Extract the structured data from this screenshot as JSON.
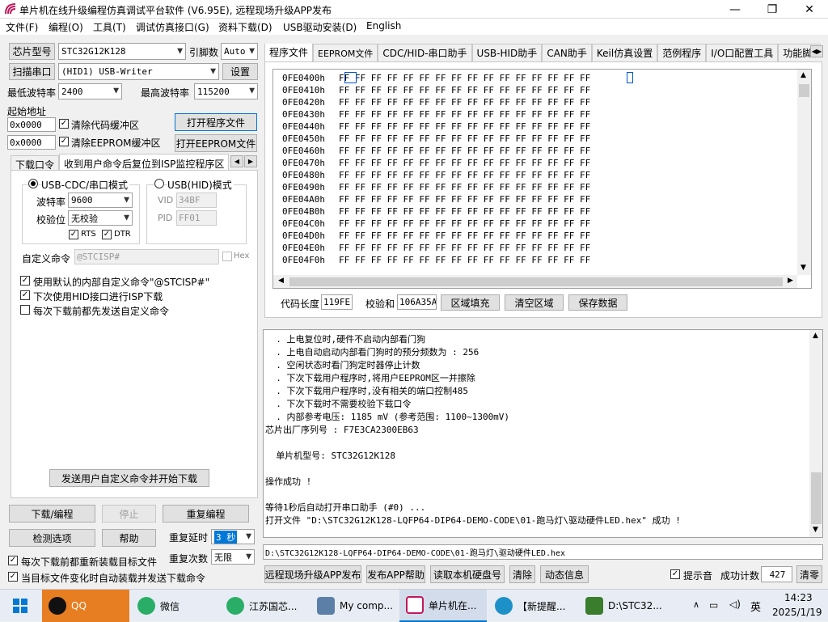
{
  "window": {
    "title": "单片机在线升级编程仿真调试平台软件 (V6.95E), 远程现场升级APP发布"
  },
  "menu": [
    "文件(F)",
    "编程(O)",
    "工具(T)",
    "调试仿真接口(G)",
    "资料下载(D)",
    "USB驱动安装(D)",
    "English"
  ],
  "left": {
    "chip_button": "芯片型号",
    "chip_value": "STC32G12K128",
    "pins_label": "引脚数",
    "pins_value": "Auto",
    "scan_button": "扫描串口",
    "port_value": "(HID1) USB-Writer",
    "settings_button": "设置",
    "min_baud_label": "最低波特率",
    "min_baud_value": "2400",
    "max_baud_label": "最高波特率",
    "max_baud_value": "115200",
    "start_addr_label": "起始地址",
    "addr1_value": "0x0000",
    "clear_code_label": "清除代码缓冲区",
    "open_program_button": "打开程序文件",
    "addr2_value": "0x0000",
    "clear_eeprom_label": "清除EEPROM缓冲区",
    "open_eeprom_button": "打开EEPROM文件",
    "subtabs": [
      "下载口令",
      "收到用户命令后复位到ISP监控程序区"
    ],
    "usb_cdc_label": "USB-CDC/串口模式",
    "usb_hid_label": "USB(HID)模式",
    "baud_label": "波特率",
    "baud_value": "9600",
    "parity_label": "校验位",
    "parity_value": "无校验",
    "rts_label": "RTS",
    "dtr_label": "DTR",
    "vid_label": "VID",
    "vid_value": "34BF",
    "pid_label": "PID",
    "pid_value": "FF01",
    "custom_cmd_label": "自定义命令",
    "custom_cmd_value": "@STCISP#",
    "hex_label": "Hex",
    "opt1": "使用默认的内部自定义命令\"@STCISP#\"",
    "opt2": "下次使用HID接口进行ISP下载",
    "opt3": "每次下载前都先发送自定义命令",
    "send_cmd_button": "发送用户自定义命令并开始下载",
    "download_button": "下载/编程",
    "stop_button": "停止",
    "reprogram_button": "重复编程",
    "check_button": "检测选项",
    "help_button": "帮助",
    "repeat_delay_label": "重复延时",
    "repeat_delay_value": "3 秒",
    "repeat_count_label": "重复次数",
    "repeat_count_value": "无限",
    "reload_label": "每次下载前都重新装载目标文件",
    "autoload_label": "当目标文件变化时自动装载并发送下载命令"
  },
  "right": {
    "tabs": [
      "程序文件",
      "EEPROM文件",
      "CDC/HID-串口助手",
      "USB-HID助手",
      "CAN助手",
      "Keil仿真设置",
      "范例程序",
      "I/O口配置工具",
      "功能脚切"
    ],
    "hex_rows": [
      {
        "addr": "0FE0400h",
        "data": "FF FF FF FF FF FF FF FF FF FF FF FF FF FF FF FF"
      },
      {
        "addr": "0FE0410h",
        "data": "FF FF FF FF FF FF FF FF FF FF FF FF FF FF FF FF"
      },
      {
        "addr": "0FE0420h",
        "data": "FF FF FF FF FF FF FF FF FF FF FF FF FF FF FF FF"
      },
      {
        "addr": "0FE0430h",
        "data": "FF FF FF FF FF FF FF FF FF FF FF FF FF FF FF FF"
      },
      {
        "addr": "0FE0440h",
        "data": "FF FF FF FF FF FF FF FF FF FF FF FF FF FF FF FF"
      },
      {
        "addr": "0FE0450h",
        "data": "FF FF FF FF FF FF FF FF FF FF FF FF FF FF FF FF"
      },
      {
        "addr": "0FE0460h",
        "data": "FF FF FF FF FF FF FF FF FF FF FF FF FF FF FF FF"
      },
      {
        "addr": "0FE0470h",
        "data": "FF FF FF FF FF FF FF FF FF FF FF FF FF FF FF FF"
      },
      {
        "addr": "0FE0480h",
        "data": "FF FF FF FF FF FF FF FF FF FF FF FF FF FF FF FF"
      },
      {
        "addr": "0FE0490h",
        "data": "FF FF FF FF FF FF FF FF FF FF FF FF FF FF FF FF"
      },
      {
        "addr": "0FE04A0h",
        "data": "FF FF FF FF FF FF FF FF FF FF FF FF FF FF FF FF"
      },
      {
        "addr": "0FE04B0h",
        "data": "FF FF FF FF FF FF FF FF FF FF FF FF FF FF FF FF"
      },
      {
        "addr": "0FE04C0h",
        "data": "FF FF FF FF FF FF FF FF FF FF FF FF FF FF FF FF"
      },
      {
        "addr": "0FE04D0h",
        "data": "FF FF FF FF FF FF FF FF FF FF FF FF FF FF FF FF"
      },
      {
        "addr": "0FE04E0h",
        "data": "FF FF FF FF FF FF FF FF FF FF FF FF FF FF FF FF"
      },
      {
        "addr": "0FE04F0h",
        "data": "FF FF FF FF FF FF FF FF FF FF FF FF FF FF FF FF"
      }
    ],
    "code_len_label": "代码长度",
    "code_len_value": "119FE",
    "checksum_label": "校验和",
    "checksum_value": "106A35A",
    "fill_button": "区域填充",
    "clear_button": "清空区域",
    "save_button": "保存数据"
  },
  "log": [
    "  . 上电复位时,硬件不启动内部看门狗",
    "  . 上电自动启动内部看门狗时的预分频数为 : 256",
    "  . 空闲状态时看门狗定时器停止计数",
    "  . 下次下载用户程序时,将用户EEPROM区一并擦除",
    "  . 下次下载用户程序时,没有相关的端口控制485",
    "  . 下次下载时不需要校验下载口令",
    "  . 内部参考电压: 1185 mV (参考范围: 1100~1300mV)",
    "芯片出厂序列号 : F7E3CA2300EB63",
    "",
    "  单片机型号: STC32G12K128",
    "",
    "操作成功 !",
    "",
    "等待1秒后自动打开串口助手 (#0) ...",
    "打开文件 \"D:\\STC32G12K128-LQFP64-DIP64-DEMO-CODE\\01-跑马灯\\驱动硬件LED.hex\" 成功 !"
  ],
  "path_value": "D:\\STC32G12K128-LQFP64-DIP64-DEMO-CODE\\01-跑马灯\\驱动硬件LED.hex",
  "bottom": {
    "remote_button": "远程现场升级APP发布",
    "publish_help_button": "发布APP帮助",
    "read_disk_button": "读取本机硬盘号",
    "clear_button": "清除",
    "anim_button": "动态信息",
    "beep_label": "提示音",
    "success_label": "成功计数",
    "success_value": "427",
    "reset_button": "清零"
  },
  "taskbar": {
    "items": [
      "QQ",
      "微信",
      "江苏国芯...",
      "My comp...",
      "单片机在...",
      "【新提醒...",
      "D:\\STC32..."
    ],
    "ime": "英",
    "time": "14:23",
    "date": "2025/1/19"
  }
}
